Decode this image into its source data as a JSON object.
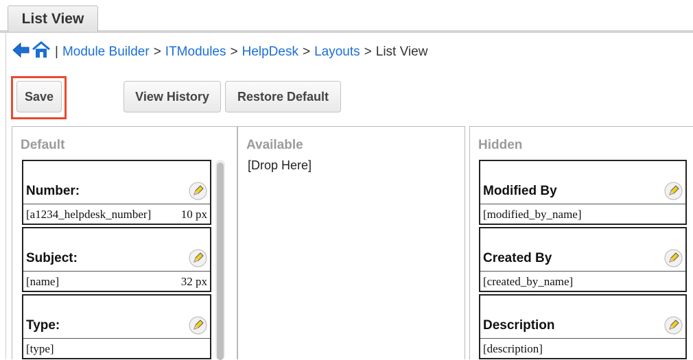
{
  "tabs": {
    "active": "List View"
  },
  "breadcrumb": {
    "separator": ">",
    "divider": "|",
    "links": [
      "Module Builder",
      "ITModules",
      "HelpDesk",
      "Layouts"
    ],
    "current": "List View"
  },
  "toolbar": {
    "save_label": "Save",
    "view_history_label": "View History",
    "restore_default_label": "Restore Default"
  },
  "panels": {
    "default": {
      "title": "Default",
      "cards": [
        {
          "label": "Number:",
          "field": "[a1234_helpdesk_number]",
          "width": "10 px"
        },
        {
          "label": "Subject:",
          "field": "[name]",
          "width": "32 px"
        },
        {
          "label": "Type:",
          "field": "[type]",
          "width": ""
        }
      ]
    },
    "available": {
      "title": "Available",
      "drop_text": "[Drop Here]"
    },
    "hidden": {
      "title": "Hidden",
      "cards": [
        {
          "label": "Modified By",
          "field": "[modified_by_name]"
        },
        {
          "label": "Created By",
          "field": "[created_by_name]"
        },
        {
          "label": "Description",
          "field": "[description]"
        }
      ]
    }
  },
  "colors": {
    "link": "#1a6fd4",
    "highlight": "#e84a2c",
    "panel_title": "#9b9b9b"
  },
  "icons": {
    "back": "back-arrow-icon",
    "home": "home-icon",
    "edit": "pencil-edit-icon"
  }
}
